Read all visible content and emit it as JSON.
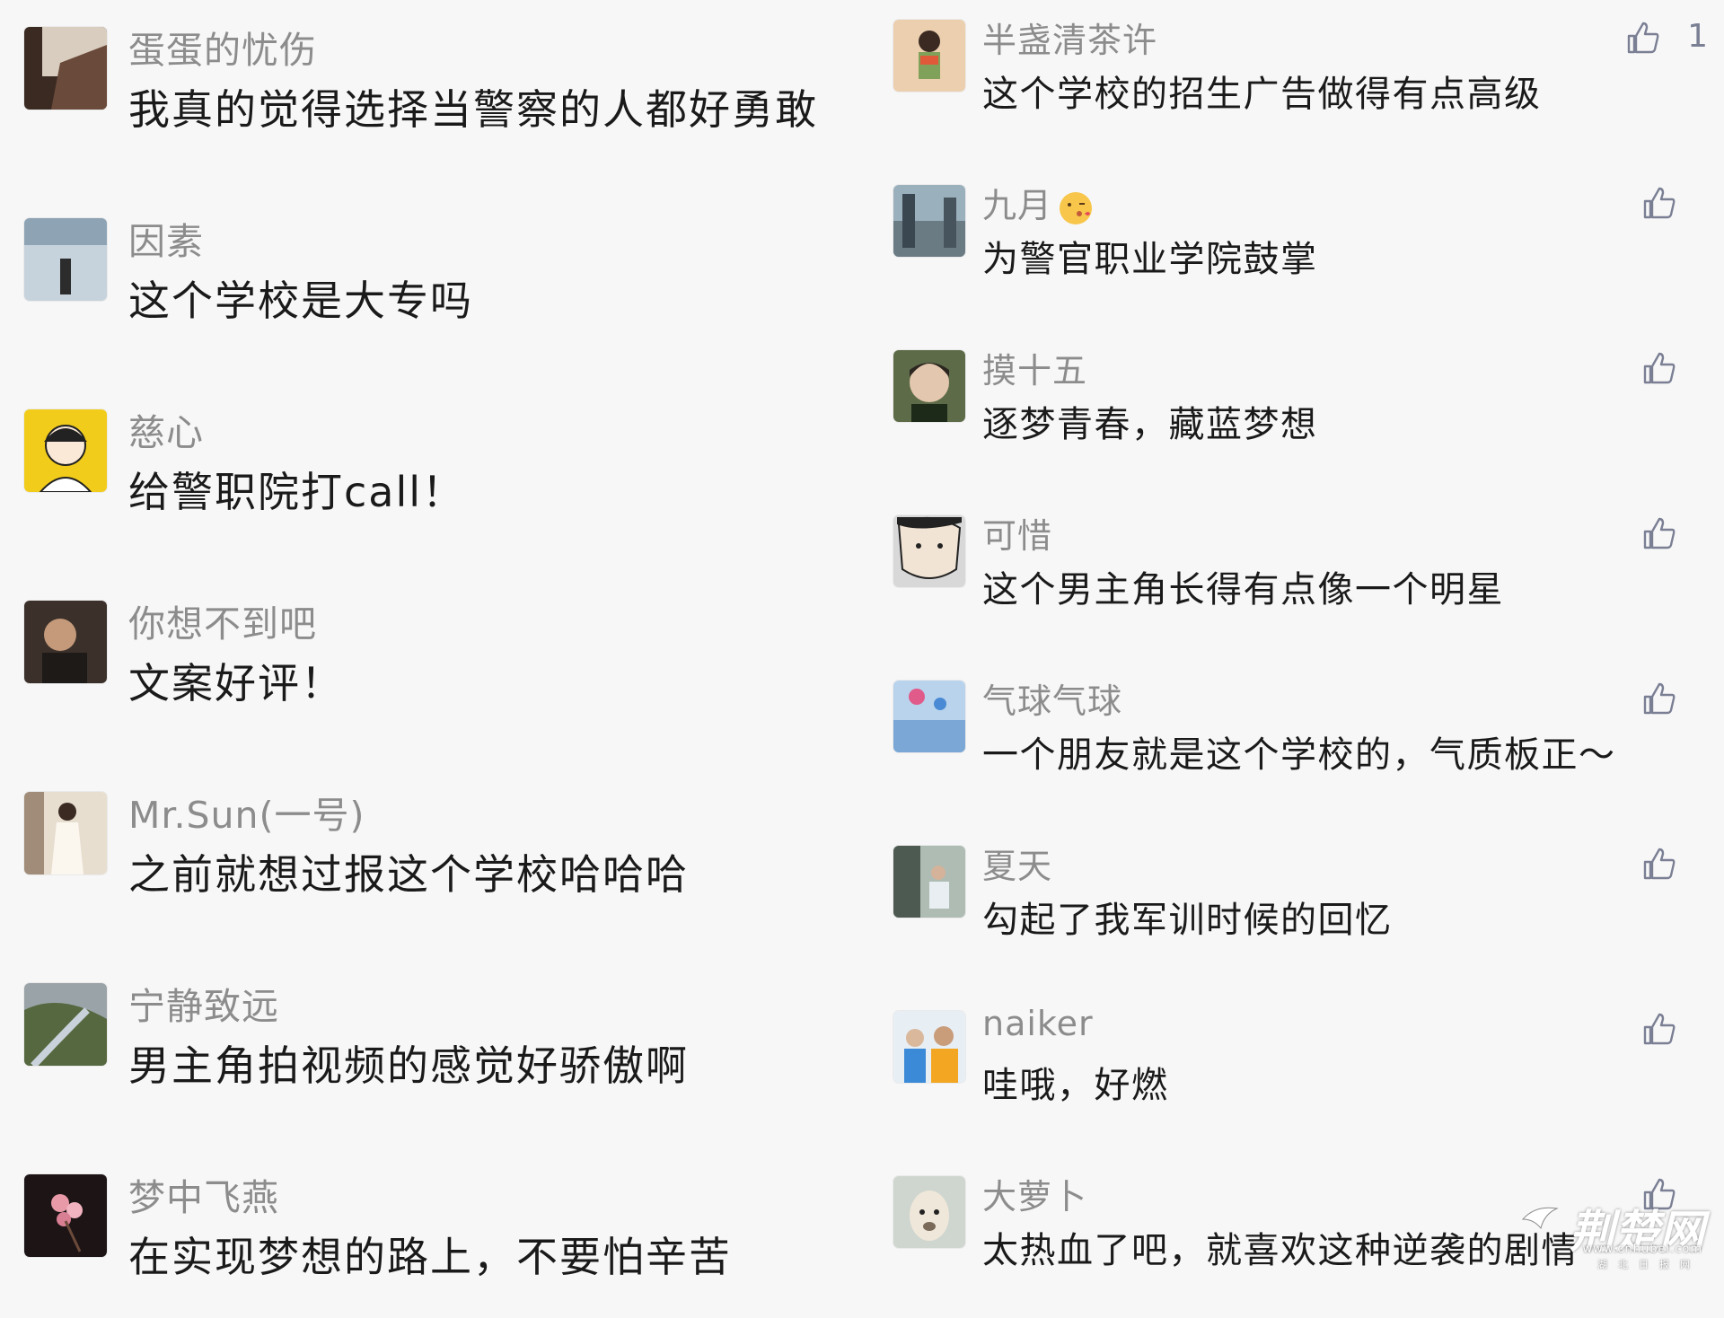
{
  "left_comments": [
    {
      "nickname": "蛋蛋的忧伤",
      "text": "我真的觉得选择当警察的人都好勇敢",
      "avatar_color": "#3a2a22"
    },
    {
      "nickname": "因素",
      "text": "这个学校是大专吗",
      "avatar_color": "#a6b7c4"
    },
    {
      "nickname": "慈心",
      "text": "给警职院打call！",
      "avatar_color": "#f2cc1b"
    },
    {
      "nickname": "你想不到吧",
      "text": "文案好评！",
      "avatar_color": "#4a3b30"
    },
    {
      "nickname": "Mr.Sun(一号)",
      "text": "之前就想过报这个学校哈哈哈",
      "avatar_color": "#d6c7b3"
    },
    {
      "nickname": "宁静致远",
      "text": "男主角拍视频的感觉好骄傲啊",
      "avatar_color": "#6b7a5c"
    },
    {
      "nickname": "梦中飞燕",
      "text": "在实现梦想的路上，不要怕辛苦",
      "avatar_color": "#1d1416"
    }
  ],
  "right_comments": [
    {
      "nickname": "半盏清茶许",
      "text": "这个学校的招生广告做得有点高级",
      "like_count": "1",
      "avatar_color": "#e9c5a0"
    },
    {
      "nickname": "九月",
      "text": "为警官职业学院鼓掌",
      "emoji": "kiss-face-emoji",
      "avatar_color": "#7a8a93"
    },
    {
      "nickname": "摸十五",
      "text": "逐梦青春，藏蓝梦想",
      "avatar_color": "#5d6b48"
    },
    {
      "nickname": "可惜",
      "text": "这个男主角长得有点像一个明星",
      "avatar_color": "#8f8f8f"
    },
    {
      "nickname": "气球气球",
      "text": "一个朋友就是这个学校的，气质板正～",
      "avatar_color": "#8fb5dd"
    },
    {
      "nickname": "夏天",
      "text": "勾起了我军训时候的回忆",
      "avatar_color": "#7b8f86"
    },
    {
      "nickname": "naiker",
      "text": "哇哦，好燃",
      "avatar_color": "#dfe7ef"
    },
    {
      "nickname": "大萝卜",
      "text": "太热血了吧，就喜欢这种逆袭的剧情",
      "avatar_color": "#c9c2b4"
    }
  ],
  "icons": {
    "like": "thumbs-up-icon"
  },
  "colors": {
    "background": "#f7f7f7",
    "nickname": "#8c8c8c",
    "comment_text": "#1a1a1a",
    "like_icon": "#7a7f94"
  },
  "watermark": {
    "title": "荆楚网",
    "url": "www.cnhubei.com",
    "tagline": "湖北日报网"
  }
}
